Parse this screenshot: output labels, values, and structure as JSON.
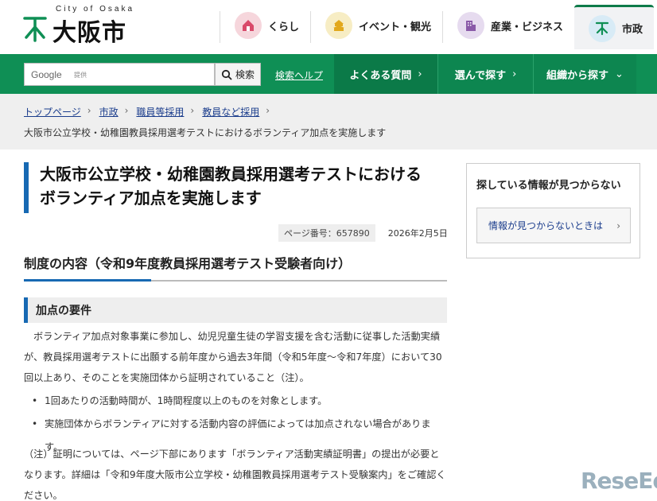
{
  "header": {
    "logo_en": "City of Osaka",
    "logo_jp": "大阪市",
    "nav": [
      {
        "label": "くらし",
        "icon": "house-icon",
        "color": "#f6d6dc"
      },
      {
        "label": "イベント・観光",
        "icon": "castle-icon",
        "color": "#f7edc4"
      },
      {
        "label": "産業・ビジネス",
        "icon": "building-icon",
        "color": "#e6dbef"
      },
      {
        "label": "市政",
        "icon": "city-mark-icon",
        "color": "#d8ebf6"
      }
    ]
  },
  "search": {
    "provider": "Google",
    "provided": "提供",
    "button_label": "検索",
    "help_link": "検索ヘルプ"
  },
  "global_nav": [
    {
      "label": "よくある質問"
    },
    {
      "label": "選んで探す"
    },
    {
      "label": "組織から探す"
    }
  ],
  "breadcrumb": {
    "items": [
      "トップページ",
      "市政",
      "職員等採用",
      "教員など採用"
    ],
    "current": "大阪市公立学校・幼稚園教員採用選考テストにおけるボランティア加点を実施します"
  },
  "page": {
    "title_line1": "大阪市公立学校・幼稚園教員採用選考テストにおける",
    "title_line2": "ボランティア加点を実施します",
    "page_number": "ページ番号：657890",
    "date": "2026年2月5日",
    "section_title": "制度の内容（令和9年度教員採用選考テスト受験者向け）",
    "subsection_title": "加点の要件",
    "paragraph1": "ボランティア加点対象事業に参加し、幼児児童生徒の学習支援を含む活動に従事した活動実績が、教員採用選考テストに出願する前年度から過去3年間（令和5年度～令和7年度）において30回以上あり、そのことを実施団体から証明されていること（注）。",
    "bullets": [
      "1回あたりの活動時間が、1時間程度以上のものを対象とします。",
      "実施団体からボランティアに対する活動内容の評価によっては加点されない場合があります。"
    ],
    "paragraph2": "（注）証明については、ページ下部にあります「ボランティア活動実績証明書」の提出が必要となります。詳細は「令和9年度大阪市公立学校・幼稚園教員採用選考テスト受験案内」をご確認ください。"
  },
  "sidebar": {
    "title": "探している情報が見つからない",
    "link": "情報が見つからないときは"
  },
  "watermark": "ReseEd",
  "colors": {
    "green": "#0f8f55",
    "accent_blue": "#1769b3",
    "link": "#1a3c8c"
  }
}
